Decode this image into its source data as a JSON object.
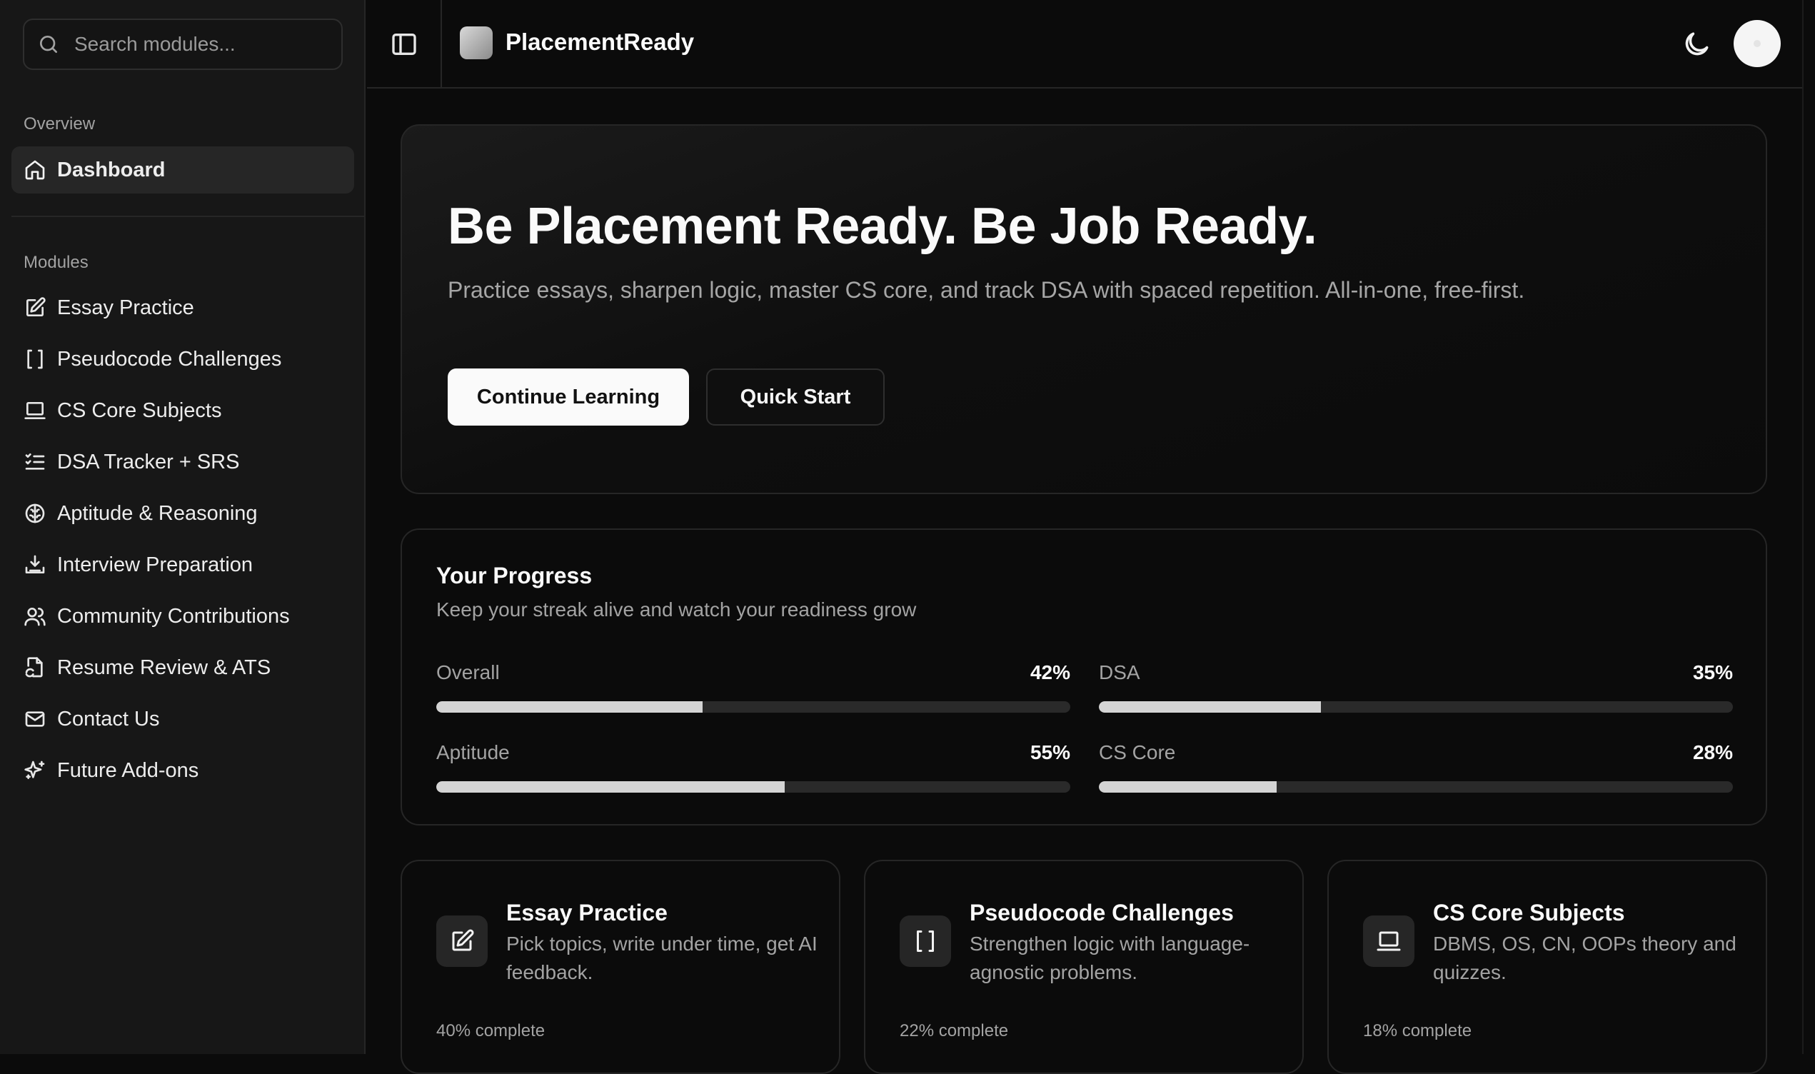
{
  "search": {
    "placeholder": "Search modules..."
  },
  "sidebar": {
    "overview_label": "Overview",
    "dashboard_label": "Dashboard",
    "modules_label": "Modules",
    "items": [
      {
        "label": "Essay Practice",
        "icon": "edit-icon"
      },
      {
        "label": "Pseudocode Challenges",
        "icon": "brackets-icon"
      },
      {
        "label": "CS Core Subjects",
        "icon": "laptop-icon"
      },
      {
        "label": "DSA Tracker + SRS",
        "icon": "list-checks-icon"
      },
      {
        "label": "Aptitude & Reasoning",
        "icon": "brain-icon"
      },
      {
        "label": "Interview Preparation",
        "icon": "download-icon"
      },
      {
        "label": "Community Contributions",
        "icon": "users-icon"
      },
      {
        "label": "Resume Review & ATS",
        "icon": "file-sync-icon"
      },
      {
        "label": "Contact Us",
        "icon": "mail-icon"
      },
      {
        "label": "Future Add-ons",
        "icon": "sparkles-icon"
      }
    ]
  },
  "header": {
    "app_name": "PlacementReady"
  },
  "hero": {
    "title": "Be Placement Ready. Be Job Ready.",
    "subtitle": "Practice essays, sharpen logic, master CS core, and track DSA with spaced repetition. All-in-one, free-first.",
    "primary_button": "Continue Learning",
    "secondary_button": "Quick Start"
  },
  "progress": {
    "title": "Your Progress",
    "subtitle": "Keep your streak alive and watch your readiness grow",
    "metrics": [
      {
        "label": "Overall",
        "value": "42%",
        "fraction": 0.42
      },
      {
        "label": "DSA",
        "value": "35%",
        "fraction": 0.35
      },
      {
        "label": "Aptitude",
        "value": "55%",
        "fraction": 0.55
      },
      {
        "label": "CS Core",
        "value": "28%",
        "fraction": 0.28
      }
    ]
  },
  "modules": [
    {
      "title": "Essay Practice",
      "desc": "Pick topics, write under time, get AI feedback.",
      "progress": "40% complete",
      "icon": "edit-icon"
    },
    {
      "title": "Pseudocode Challenges",
      "desc": "Strengthen logic with language-agnostic problems.",
      "progress": "22% complete",
      "icon": "brackets-icon"
    },
    {
      "title": "CS Core Subjects",
      "desc": "DBMS, OS, CN, OOPs theory and quizzes.",
      "progress": "18% complete",
      "icon": "laptop-icon"
    }
  ]
}
